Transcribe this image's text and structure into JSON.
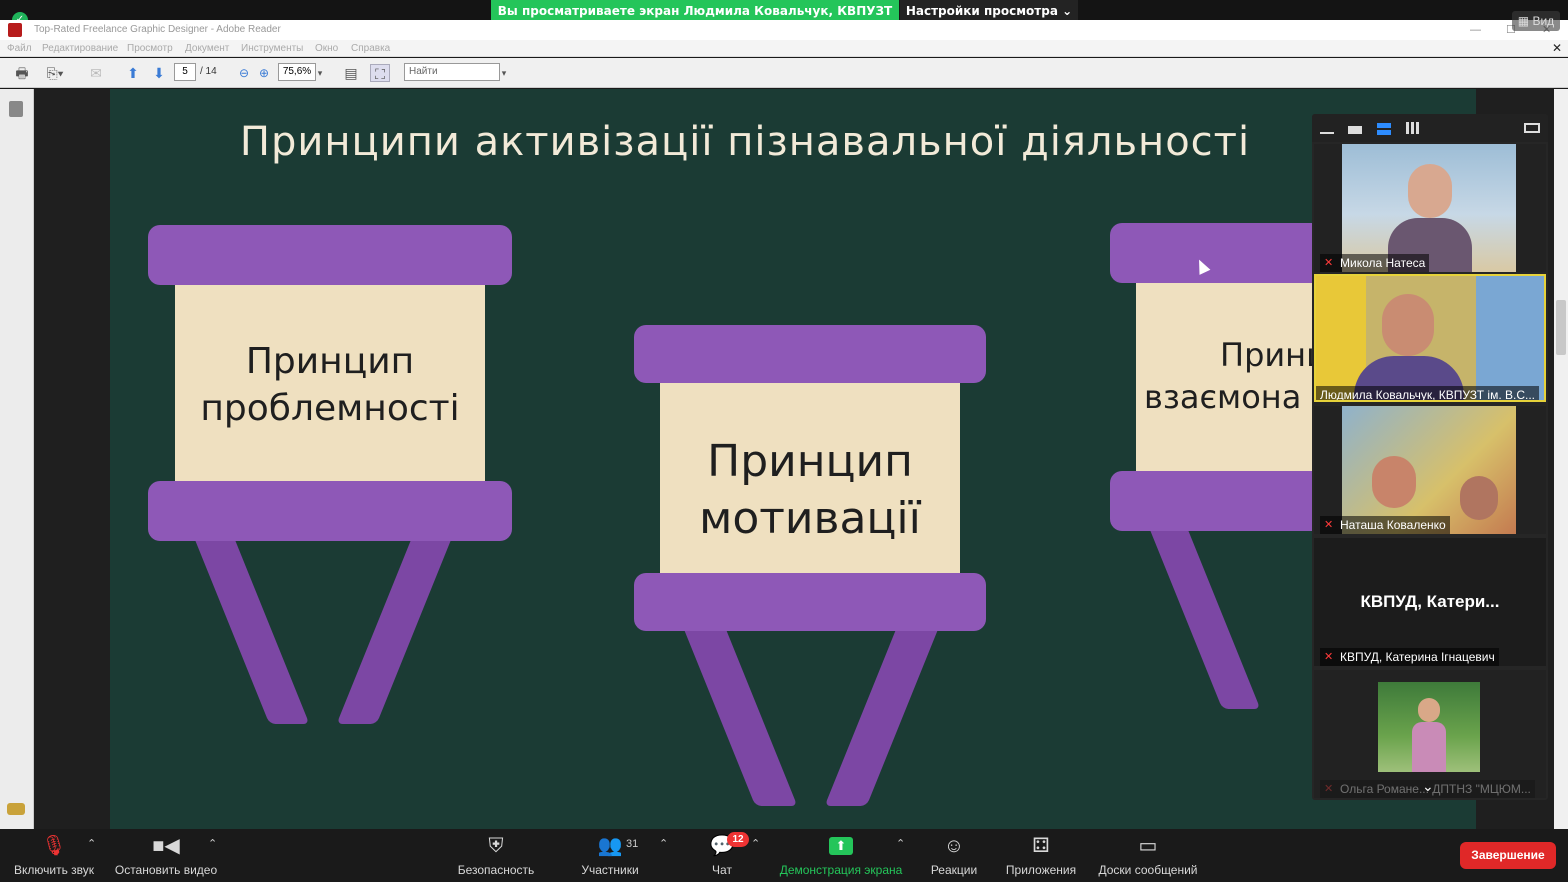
{
  "top": {
    "banner": "Вы просматриваете экран Людмила Ковальчук, КВПУЗТ ім. ...",
    "settings": "Настройки просмотра ⌄",
    "view_button": "Вид"
  },
  "reader": {
    "title": "Top-Rated Freelance Graphic Designer - Adobe Reader",
    "menu": [
      "Файл",
      "Редактирование",
      "Просмотр",
      "Документ",
      "Инструменты",
      "Окно",
      "Справка"
    ],
    "page_current": "5",
    "page_total": "/ 14",
    "zoom": "75,6%",
    "find_placeholder": "Найти"
  },
  "slide": {
    "title": "Принципи активізації пізнавальної діяльності",
    "easels": [
      {
        "line1": "Принцип",
        "line2": "проблемності"
      },
      {
        "line1": "Принцип",
        "line2": "мотивації"
      },
      {
        "line1": "Принц",
        "line2": "взаємона"
      }
    ]
  },
  "participants": [
    {
      "name": "Микола Натеса",
      "muted": true
    },
    {
      "name": "Людмила Ковальчук, КВПУЗТ ім. В.С...",
      "muted": false
    },
    {
      "name": "Наташа Коваленко",
      "muted": true
    },
    {
      "name": "КВПУД, Катерина Ігнацевич",
      "muted": true,
      "display": "КВПУД,  Катери..."
    },
    {
      "name": "Ольга Романе... ДПТНЗ \"МЦЮМ...",
      "muted": true
    }
  ],
  "toolbar": {
    "unmute": "Включить звук",
    "stop_video": "Остановить видео",
    "security": "Безопасность",
    "participants": "Участники",
    "participants_count": "31",
    "chat": "Чат",
    "chat_badge": "12",
    "share": "Демонстрация экрана",
    "reactions": "Реакции",
    "apps": "Приложения",
    "whiteboards": "Доски сообщений",
    "end": "Завершение"
  },
  "colors": {
    "slide_bg": "#1b3b34",
    "easel_purple": "#8e58b7",
    "board_cream": "#efe0c0",
    "zoom_green": "#24c55a",
    "end_red": "#e02828"
  }
}
